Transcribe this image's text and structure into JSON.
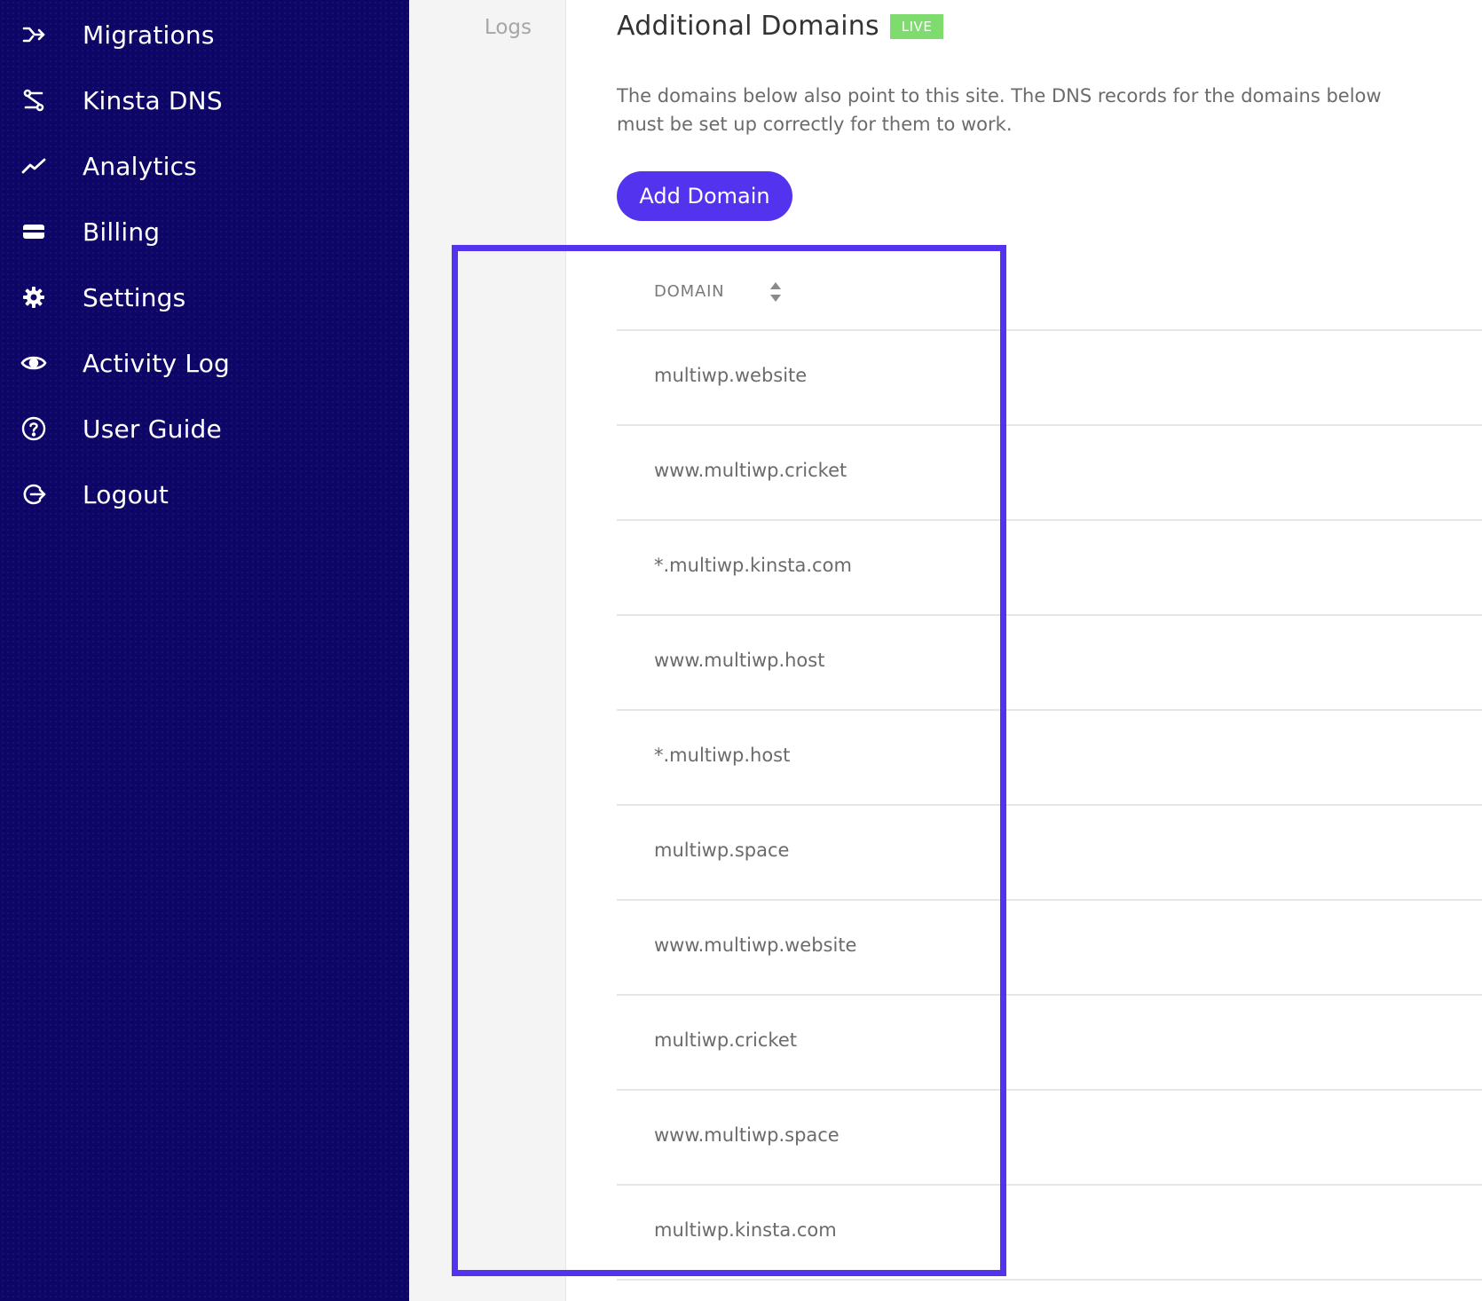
{
  "colors": {
    "sidebar_bg": "#0e0666",
    "accent": "#5333ed",
    "live_badge": "#7edc6f",
    "subnav_bg": "#f4f4f4"
  },
  "sidebar": {
    "items": [
      {
        "label": "Migrations",
        "icon": "migrations-icon"
      },
      {
        "label": "Kinsta DNS",
        "icon": "dns-icon"
      },
      {
        "label": "Analytics",
        "icon": "analytics-icon"
      },
      {
        "label": "Billing",
        "icon": "billing-icon"
      },
      {
        "label": "Settings",
        "icon": "gear-icon"
      },
      {
        "label": "Activity Log",
        "icon": "eye-icon"
      },
      {
        "label": "User Guide",
        "icon": "help-icon"
      },
      {
        "label": "Logout",
        "icon": "logout-icon"
      }
    ]
  },
  "subnav": {
    "logs_label": "Logs"
  },
  "main": {
    "title": "Additional Domains",
    "badge": "LIVE",
    "description": "The domains below also point to this site. The DNS records for the domains below must be set up correctly for them to work.",
    "add_button": "Add Domain"
  },
  "table": {
    "column_header": "DOMAIN",
    "rows": [
      "multiwp.website",
      "www.multiwp.cricket",
      "*.multiwp.kinsta.com",
      "www.multiwp.host",
      "*.multiwp.host",
      "multiwp.space",
      "www.multiwp.website",
      "multiwp.cricket",
      "www.multiwp.space",
      "multiwp.kinsta.com"
    ]
  }
}
